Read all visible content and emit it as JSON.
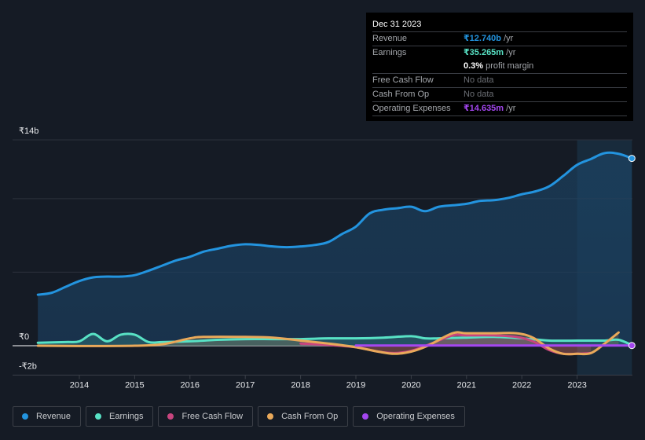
{
  "tooltip": {
    "date": "Dec 31 2023",
    "rows": [
      {
        "label": "Revenue",
        "value": "₹12.740b",
        "unit": " /yr",
        "color": "#2394df"
      },
      {
        "label": "Earnings",
        "value": "₹35.265m",
        "unit": " /yr",
        "color": "#58e2c5"
      },
      {
        "label": "",
        "value": "0.3%",
        "unit": " profit margin",
        "color": "#ffffff"
      },
      {
        "label": "Free Cash Flow",
        "value": "No data",
        "unit": "",
        "color": "#6b6e74"
      },
      {
        "label": "Cash From Op",
        "value": "No data",
        "unit": "",
        "color": "#6b6e74"
      },
      {
        "label": "Operating Expenses",
        "value": "₹14.635m",
        "unit": " /yr",
        "color": "#a447f0"
      }
    ]
  },
  "legend": [
    {
      "label": "Revenue",
      "color": "#2394df"
    },
    {
      "label": "Earnings",
      "color": "#58e2c5"
    },
    {
      "label": "Free Cash Flow",
      "color": "#c7457e"
    },
    {
      "label": "Cash From Op",
      "color": "#e9a95a"
    },
    {
      "label": "Operating Expenses",
      "color": "#a447f0"
    }
  ],
  "chart_data": {
    "type": "area",
    "title": "",
    "xlabel": "",
    "ylabel": "",
    "y_unit": "₹ billions",
    "ylim": [
      -2,
      14
    ],
    "xlim": [
      2013.25,
      2023.99
    ],
    "y_tick_labels": [
      {
        "value": 14,
        "label": "₹14b"
      },
      {
        "value": 0,
        "label": "₹0"
      },
      {
        "value": -2,
        "label": "-₹2b"
      }
    ],
    "gridlines": [
      14,
      10,
      5,
      0
    ],
    "x_ticks": [
      2014,
      2015,
      2016,
      2017,
      2018,
      2019,
      2020,
      2021,
      2022,
      2023
    ],
    "highlight_from": 2023,
    "highlight_to": 2023.99,
    "legend_position": "bottom",
    "series": [
      {
        "name": "Revenue",
        "color": "#2394df",
        "fill": true,
        "end_marker": true,
        "x": [
          2013.25,
          2013.5,
          2013.75,
          2014.0,
          2014.25,
          2014.5,
          2014.75,
          2015.0,
          2015.25,
          2015.5,
          2015.75,
          2016.0,
          2016.25,
          2016.5,
          2016.75,
          2017.0,
          2017.25,
          2017.5,
          2017.75,
          2018.0,
          2018.25,
          2018.5,
          2018.75,
          2019.0,
          2019.25,
          2019.5,
          2019.75,
          2020.0,
          2020.25,
          2020.5,
          2020.75,
          2021.0,
          2021.25,
          2021.5,
          2021.75,
          2022.0,
          2022.25,
          2022.5,
          2022.75,
          2023.0,
          2023.25,
          2023.5,
          2023.75,
          2023.99
        ],
        "values": [
          3.47,
          3.6,
          4.0,
          4.4,
          4.65,
          4.7,
          4.7,
          4.8,
          5.1,
          5.45,
          5.8,
          6.05,
          6.4,
          6.6,
          6.8,
          6.9,
          6.85,
          6.75,
          6.7,
          6.75,
          6.85,
          7.05,
          7.6,
          8.1,
          9.0,
          9.25,
          9.35,
          9.45,
          9.15,
          9.45,
          9.55,
          9.65,
          9.85,
          9.9,
          10.05,
          10.3,
          10.5,
          10.85,
          11.55,
          12.3,
          12.7,
          13.1,
          13.05,
          12.74
        ]
      },
      {
        "name": "Earnings",
        "color": "#58e2c5",
        "fill": true,
        "x": [
          2013.25,
          2013.75,
          2014.0,
          2014.25,
          2014.5,
          2014.75,
          2015.0,
          2015.25,
          2015.5,
          2016.0,
          2016.5,
          2017.0,
          2017.5,
          2018.0,
          2018.5,
          2019.0,
          2019.5,
          2020.0,
          2020.25,
          2020.5,
          2021.0,
          2021.5,
          2022.0,
          2022.5,
          2023.0,
          2023.5,
          2023.75,
          2023.99
        ],
        "values": [
          0.2,
          0.25,
          0.3,
          0.8,
          0.3,
          0.75,
          0.75,
          0.25,
          0.25,
          0.3,
          0.4,
          0.45,
          0.45,
          0.45,
          0.5,
          0.5,
          0.55,
          0.65,
          0.5,
          0.5,
          0.55,
          0.6,
          0.5,
          0.35,
          0.35,
          0.35,
          0.4,
          0.035
        ]
      },
      {
        "name": "Free Cash Flow",
        "color": "#c7457e",
        "fill": true,
        "x": [
          2018.0,
          2018.5,
          2019.0,
          2019.4,
          2019.7,
          2020.0,
          2020.3,
          2020.75,
          2021.0,
          2021.5,
          2021.9,
          2022.2,
          2022.5,
          2022.75,
          2023.0,
          2023.25
        ],
        "values": [
          0.15,
          0.05,
          -0.1,
          -0.4,
          -0.5,
          -0.35,
          0.05,
          0.7,
          0.7,
          0.7,
          0.6,
          0.3,
          -0.3,
          -0.55,
          -0.55,
          -0.5
        ]
      },
      {
        "name": "Cash From Op",
        "color": "#e9a95a",
        "fill": true,
        "x": [
          2013.25,
          2014.0,
          2015.0,
          2015.5,
          2016.0,
          2016.25,
          2017.0,
          2017.5,
          2018.0,
          2018.5,
          2019.0,
          2019.4,
          2019.7,
          2020.0,
          2020.3,
          2020.75,
          2021.0,
          2021.5,
          2021.9,
          2022.2,
          2022.5,
          2022.75,
          2023.0,
          2023.25,
          2023.5,
          2023.75
        ],
        "values": [
          0.0,
          -0.02,
          0.0,
          0.1,
          0.5,
          0.6,
          0.6,
          0.55,
          0.35,
          0.15,
          -0.1,
          -0.4,
          -0.55,
          -0.4,
          0.0,
          0.85,
          0.85,
          0.85,
          0.85,
          0.55,
          -0.2,
          -0.55,
          -0.55,
          -0.5,
          0.15,
          0.9
        ]
      },
      {
        "name": "Operating Expenses",
        "color": "#a447f0",
        "fill": false,
        "end_marker": true,
        "x": [
          2019.0,
          2023.99
        ],
        "values": [
          0.015,
          0.015
        ]
      }
    ]
  }
}
